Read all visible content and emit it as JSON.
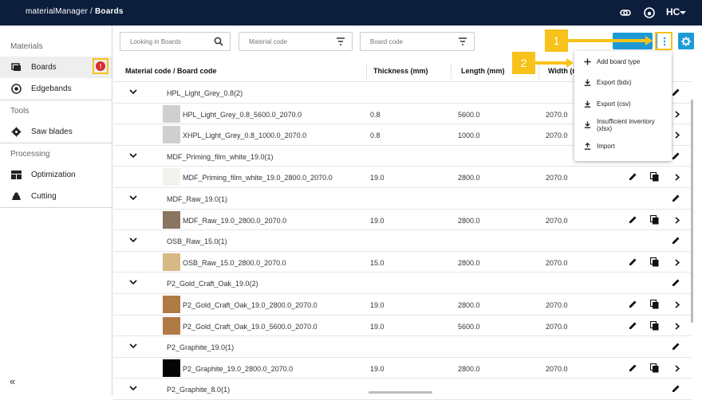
{
  "app": {
    "name": "materialManager",
    "separator": "/",
    "page": "Boards",
    "logo_text": "HC"
  },
  "sidebar": {
    "sections": [
      {
        "title": "Materials",
        "items": [
          {
            "label": "Boards",
            "icon": "boards-icon",
            "active": true
          },
          {
            "label": "Edgebands",
            "icon": "edgeband-icon"
          }
        ]
      },
      {
        "title": "Tools",
        "items": [
          {
            "label": "Saw blades",
            "icon": "saw-blade-icon"
          }
        ]
      },
      {
        "title": "Processing",
        "items": [
          {
            "label": "Optimization",
            "icon": "optimization-icon"
          },
          {
            "label": "Cutting",
            "icon": "cutting-icon"
          }
        ]
      }
    ],
    "badge": "!",
    "collapse": "«"
  },
  "filters": {
    "search_placeholder": "Looking in Boards",
    "material_code": "Material code",
    "board_code": "Board code"
  },
  "table": {
    "headers": {
      "code": "Material code / Board code",
      "thickness": "Thickness (mm)",
      "length": "Length (mm)",
      "width": "Width (m"
    },
    "rows": [
      {
        "type": "group",
        "label": "HPL_Light_Grey_0.8",
        "count": "(2)"
      },
      {
        "type": "item",
        "label": "HPL_Light_Grey_0.8_5600.0_2070.0",
        "thickness": "0.8",
        "length": "5600.0",
        "width": "2070.0",
        "swatch": "#cfcfcf",
        "actions": "chevron"
      },
      {
        "type": "item",
        "label": "XHPL_Light_Grey_0.8_1000.0_2070.0",
        "thickness": "0.8",
        "length": "1000.0",
        "width": "2070.0",
        "swatch": "#cfcfcf",
        "actions": "chevron"
      },
      {
        "type": "group",
        "label": "MDF_Priming_film_white_19.0",
        "count": "(1)"
      },
      {
        "type": "item",
        "label": "MDF_Priming_film_white_19.0_2800.0_2070.0",
        "thickness": "19.0",
        "length": "2800.0",
        "width": "2070.0",
        "swatch": "#f4f2ec",
        "actions": "full"
      },
      {
        "type": "group",
        "label": "MDF_Raw_19.0",
        "count": "(1)"
      },
      {
        "type": "item",
        "label": "MDF_Raw_19.0_2800.0_2070.0",
        "thickness": "19.0",
        "length": "2800.0",
        "width": "2070.0",
        "swatch": "#8a7560",
        "actions": "full"
      },
      {
        "type": "group",
        "label": "OSB_Raw_15.0",
        "count": "(1)"
      },
      {
        "type": "item",
        "label": "OSB_Raw_15.0_2800.0_2070.0",
        "thickness": "15.0",
        "length": "2800.0",
        "width": "2070.0",
        "swatch": "#d8b883",
        "actions": "full"
      },
      {
        "type": "group",
        "label": "P2_Gold_Craft_Oak_19.0",
        "count": "(2)"
      },
      {
        "type": "item",
        "label": "P2_Gold_Craft_Oak_19.0_2800.0_2070.0",
        "thickness": "19.0",
        "length": "2800.0",
        "width": "2070.0",
        "swatch": "#b07a45",
        "actions": "full"
      },
      {
        "type": "item",
        "label": "P2_Gold_Craft_Oak_19.0_5600.0_2070.0",
        "thickness": "19.0",
        "length": "5600.0",
        "width": "2070.0",
        "swatch": "#b07a45",
        "actions": "full"
      },
      {
        "type": "group",
        "label": "P2_Graphite_19.0",
        "count": "(1)"
      },
      {
        "type": "item",
        "label": "P2_Graphite_19.0_2800.0_2070.0",
        "thickness": "19.0",
        "length": "2800.0",
        "width": "2070.0",
        "swatch": "#050505",
        "actions": "full"
      },
      {
        "type": "group",
        "label": "P2_Graphite_8.0",
        "count": "(1)"
      }
    ]
  },
  "menu": {
    "items": [
      {
        "label": "Add board type",
        "icon": "plus-icon"
      },
      {
        "label": "Export (bdx)",
        "icon": "download-icon"
      },
      {
        "label": "Export (csv)",
        "icon": "download-icon"
      },
      {
        "label": "Insufficient inventory (xlsx)",
        "icon": "download-icon"
      },
      {
        "label": "Import",
        "icon": "upload-icon"
      }
    ]
  },
  "callouts": [
    "1",
    "2"
  ],
  "colors": {
    "topbar": "#0c1e3c",
    "accent": "#1d9ad6",
    "callout": "#f7c21a",
    "badge": "#d92b2b"
  }
}
